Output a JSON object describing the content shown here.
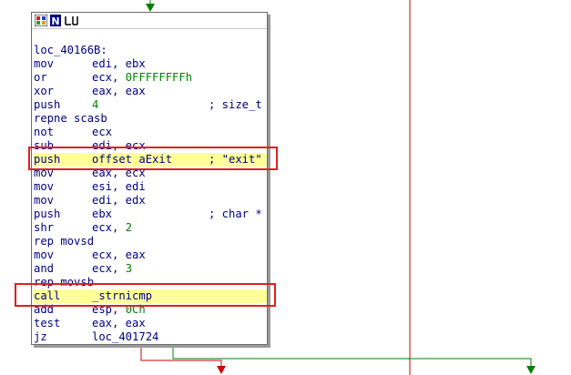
{
  "titlebar": {
    "icon_names": [
      "graph-mode-icon",
      "N-rename-icon",
      "xrefs-icon"
    ]
  },
  "colors": {
    "accent_red": "#e02020",
    "flow_green": "#008000",
    "flow_red": "#d00000",
    "highlight": "#ffff99",
    "code_blue": "#000080"
  },
  "lines": [
    {
      "mnem": "",
      "ops": "",
      "comment": ""
    },
    {
      "mnem": "loc_40166B:",
      "ops": "",
      "comment": ""
    },
    {
      "mnem": "mov",
      "ops": "edi, ebx",
      "comment": ""
    },
    {
      "mnem": "or",
      "ops": "ecx, ",
      "num": "0FFFFFFFFh",
      "comment": ""
    },
    {
      "mnem": "xor",
      "ops": "eax, eax",
      "comment": ""
    },
    {
      "mnem": "push",
      "ops": "",
      "num": "4",
      "comment": "; size_t"
    },
    {
      "mnem": "repne scasb",
      "ops": "",
      "comment": ""
    },
    {
      "mnem": "not",
      "ops": "ecx",
      "comment": ""
    },
    {
      "mnem": "sub",
      "ops": "edi, ecx",
      "comment": ""
    },
    {
      "mnem": "push",
      "ops": "offset aExit",
      "comment": "; \"exit\""
    },
    {
      "mnem": "mov",
      "ops": "eax, ecx",
      "comment": ""
    },
    {
      "mnem": "mov",
      "ops": "esi, edi",
      "comment": ""
    },
    {
      "mnem": "mov",
      "ops": "edi, edx",
      "comment": ""
    },
    {
      "mnem": "push",
      "ops": "ebx",
      "comment": "; char *"
    },
    {
      "mnem": "shr",
      "ops": "ecx, ",
      "num": "2",
      "comment": ""
    },
    {
      "mnem": "rep movsd",
      "ops": "",
      "comment": ""
    },
    {
      "mnem": "mov",
      "ops": "ecx, eax",
      "comment": ""
    },
    {
      "mnem": "and",
      "ops": "ecx, ",
      "num": "3",
      "comment": ""
    },
    {
      "mnem": "rep movsb",
      "ops": "",
      "comment": ""
    },
    {
      "mnem": "call",
      "ops": "_strnicmp",
      "comment": ""
    },
    {
      "mnem": "add",
      "ops": "esp, ",
      "num": "0Ch",
      "comment": ""
    },
    {
      "mnem": "test",
      "ops": "eax, eax",
      "comment": ""
    },
    {
      "mnem": "jz",
      "ops": "loc_401724",
      "comment": ""
    }
  ],
  "highlighted_lines": [
    "push offset aExit",
    "call _strnicmp"
  ]
}
